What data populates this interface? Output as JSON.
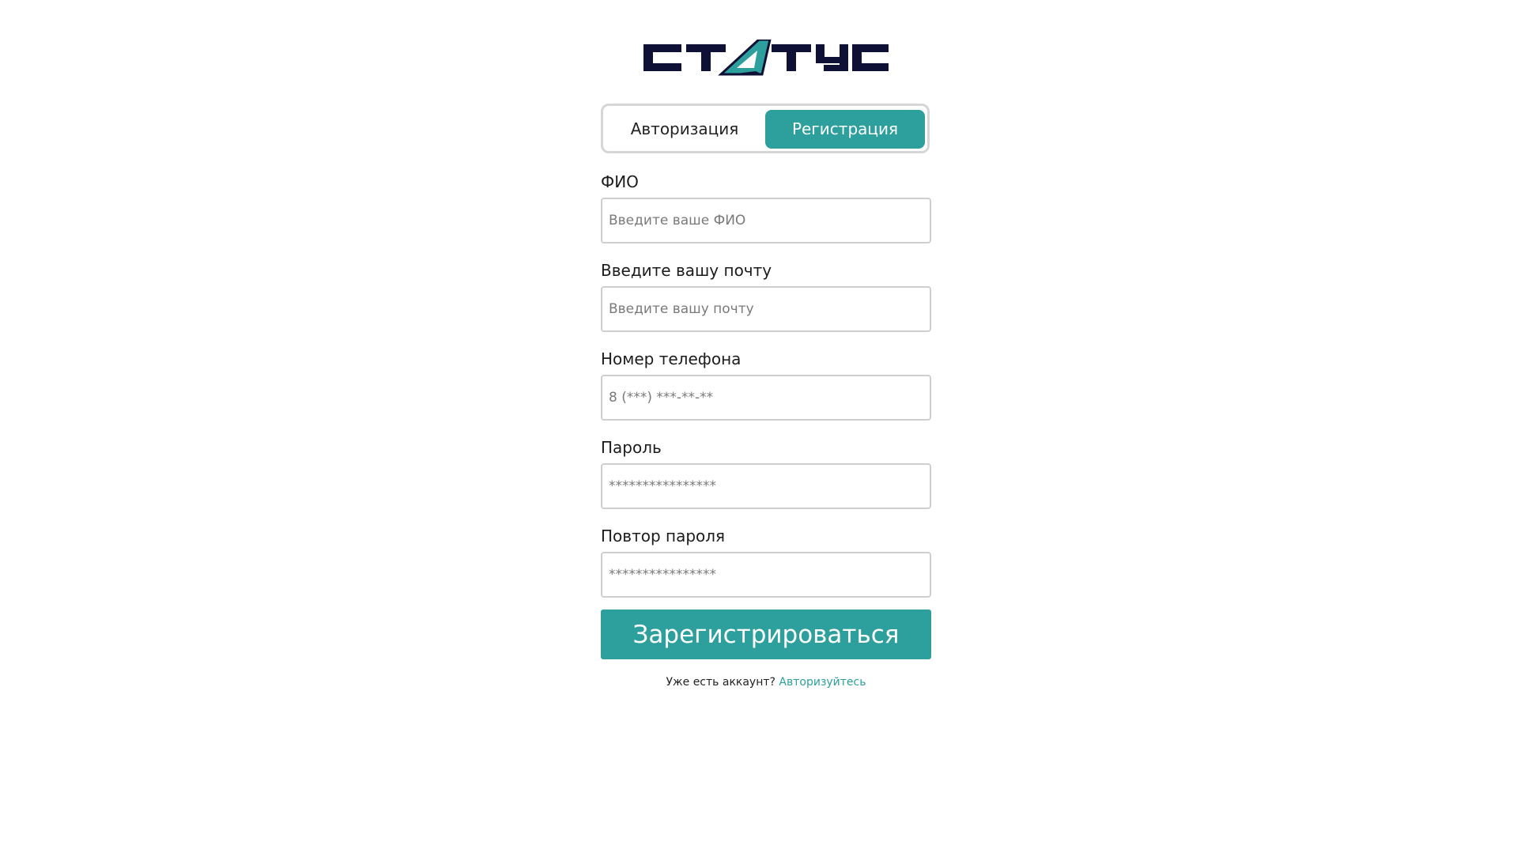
{
  "logo": {
    "text": "СТАТУС",
    "colors": {
      "dark": "#0f1035",
      "accent": "#2d9f9c"
    }
  },
  "tabs": {
    "login_label": "Авторизация",
    "register_label": "Регистрация",
    "active": "register"
  },
  "form": {
    "fio": {
      "label": "ФИО",
      "placeholder": "Введите ваше ФИО",
      "value": ""
    },
    "email": {
      "label": "Введите вашу почту",
      "placeholder": "Введите вашу почту",
      "value": ""
    },
    "phone": {
      "label": "Номер телефона",
      "placeholder": "8 (***) ***-**-**",
      "value": ""
    },
    "password": {
      "label": "Пароль",
      "placeholder": "****************",
      "value": ""
    },
    "password_repeat": {
      "label": "Повтор пароля",
      "placeholder": "****************",
      "value": ""
    },
    "submit_label": "Зарегистрироваться"
  },
  "footer": {
    "text": "Уже есть аккаунт?",
    "link_label": "Авторизуйтесь"
  },
  "colors": {
    "accent": "#2d9f9c",
    "border": "#cfcfcf",
    "text": "#1c1c1c"
  }
}
